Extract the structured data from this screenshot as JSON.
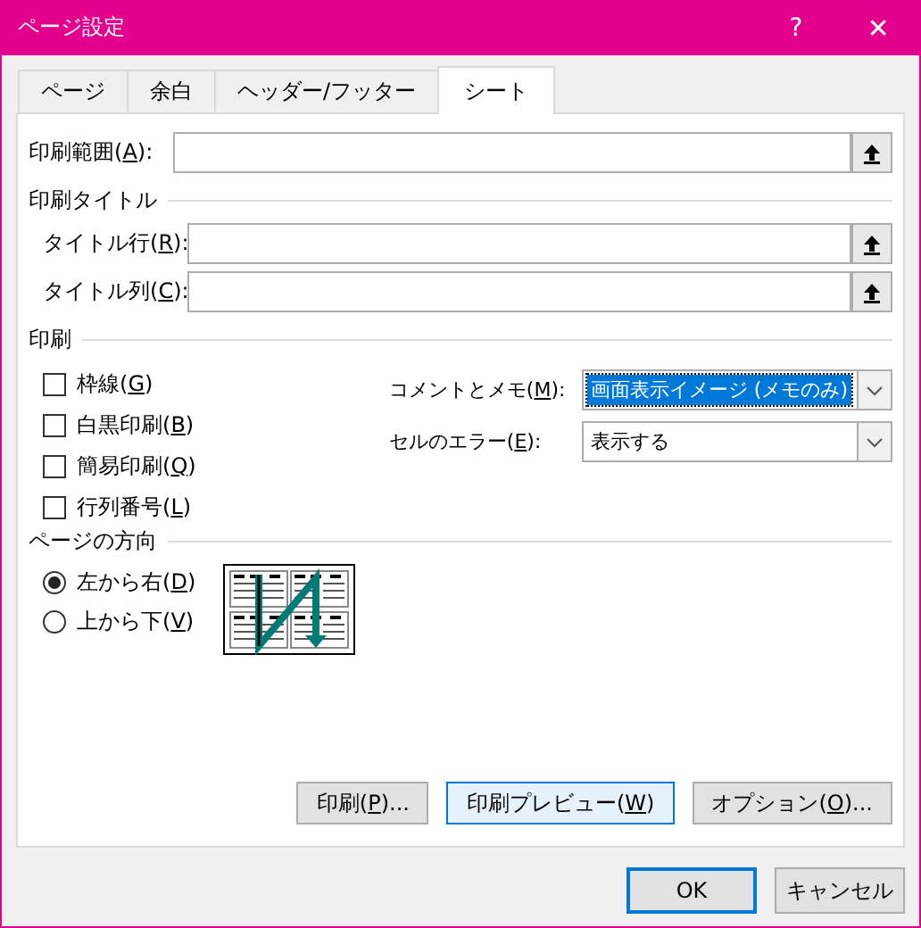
{
  "window": {
    "title": "ページ設定",
    "help": "?",
    "close": "✕"
  },
  "tabs": [
    {
      "label": "ページ",
      "selected": false
    },
    {
      "label": "余白",
      "selected": false
    },
    {
      "label": "ヘッダー/フッター",
      "selected": false
    },
    {
      "label": "シート",
      "selected": true
    }
  ],
  "print_area": {
    "label": "印刷範囲(",
    "access_key": "A",
    "label_end": "):"
  },
  "print_titles": {
    "heading": "印刷タイトル",
    "fields": [
      {
        "label": "タイトル行(",
        "access_key": "R",
        "label_end": "):"
      },
      {
        "label": "タイトル列(",
        "access_key": "C",
        "label_end": "):"
      }
    ]
  },
  "print": {
    "heading": "印刷",
    "checkboxes": [
      {
        "label": "枠線(",
        "access_key": "G",
        "label_end": ")",
        "checked": false
      },
      {
        "label": "白黒印刷(",
        "access_key": "B",
        "label_end": ")",
        "checked": false
      },
      {
        "label": "簡易印刷(",
        "access_key": "Q",
        "label_end": ")",
        "checked": false
      },
      {
        "label": "行列番号(",
        "access_key": "L",
        "label_end": ")",
        "checked": false
      }
    ],
    "dropdowns": [
      {
        "label": "コメントとメモ(",
        "access_key": "M",
        "label_end": "):",
        "value": "画面表示イメージ (メモのみ)",
        "focused": true
      },
      {
        "label": "セルのエラー(",
        "access_key": "E",
        "label_end": "):",
        "value": "表示する",
        "focused": false
      }
    ]
  },
  "page_order": {
    "heading": "ページの方向",
    "options": [
      {
        "label": "左から右(",
        "access_key": "D",
        "label_end": ")",
        "selected": true
      },
      {
        "label": "上から下(",
        "access_key": "V",
        "label_end": ")",
        "selected": false
      }
    ]
  },
  "panel_buttons": [
    {
      "label": "印刷(",
      "access_key": "P",
      "label_end": ")...",
      "hovered": false
    },
    {
      "label": "印刷プレビュー(",
      "access_key": "W",
      "label_end": ")",
      "hovered": true
    },
    {
      "label": "オプション(",
      "access_key": "O",
      "label_end": ")...",
      "hovered": false
    }
  ],
  "dialog_buttons": [
    {
      "label": "OK",
      "default": true
    },
    {
      "label": "キャンセル",
      "default": false
    }
  ]
}
